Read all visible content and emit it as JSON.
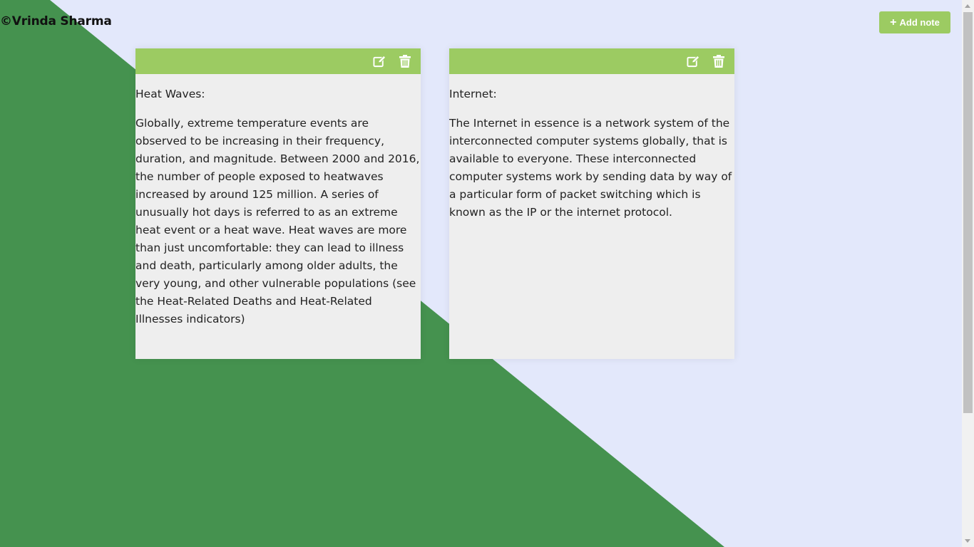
{
  "app": {
    "brand": "©Vrinda Sharma",
    "add_note_label": "Add note"
  },
  "colors": {
    "background": "#e3e8fb",
    "diagonal": "#45924f",
    "accent": "#9ccb62",
    "note_body": "#eeeeee"
  },
  "notes": [
    {
      "title": "Heat Waves:",
      "body": "Globally, extreme temperature events are observed to be increasing in their frequency, duration, and magnitude. Between 2000 and 2016, the number of people exposed to heatwaves increased by around 125 million. A series of unusually hot days is referred to as an extreme heat event or a heat wave. Heat waves are more than just uncomfortable: they can lead to illness and death, particularly among older adults, the very young, and other vulnerable populations (see the Heat-Related Deaths and Heat-Related Illnesses indicators)",
      "icons": [
        "edit-icon",
        "trash-icon"
      ]
    },
    {
      "title": "Internet:",
      "body": "The Internet in essence is a network system of the interconnected computer systems globally, that is available to everyone. These interconnected computer systems work by sending data by way of a particular form of packet switching which is known as the IP or the internet protocol.",
      "icons": [
        "edit-icon",
        "trash-icon"
      ]
    }
  ]
}
